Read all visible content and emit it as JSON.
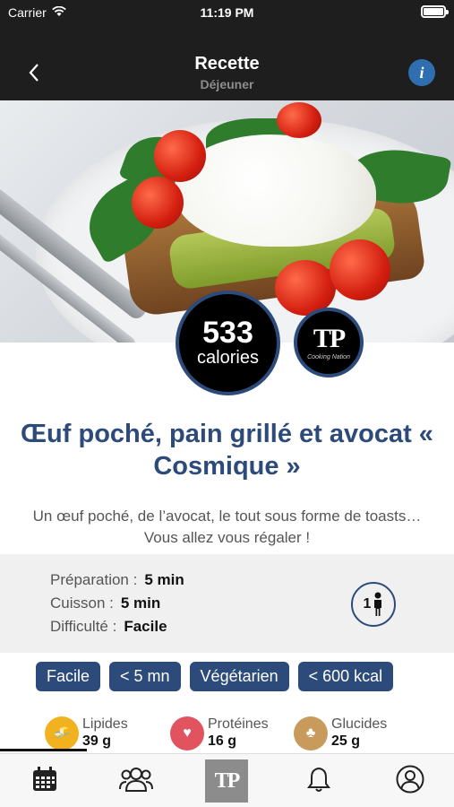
{
  "status": {
    "carrier": "Carrier",
    "time": "11:19 PM"
  },
  "nav": {
    "title": "Recette",
    "subtitle": "Déjeuner",
    "info_label": "i"
  },
  "badges": {
    "calories_value": "533",
    "calories_label": "calories",
    "brand_mark": "TP",
    "brand_sub": "Cooking Nation"
  },
  "recipe": {
    "title": "Œuf poché, pain grillé et avocat « Cosmique »",
    "description": "Un œuf poché, de l’avocat, le tout sous forme de toasts… Vous allez vous régaler !"
  },
  "details": {
    "prep_label": "Préparation :",
    "prep_value": "5 min",
    "cook_label": "Cuisson :",
    "cook_value": "5 min",
    "difficulty_label": "Difficulté :",
    "difficulty_value": "Facile",
    "servings": "1"
  },
  "tags": [
    "Facile",
    "< 5 mn",
    "Végétarien",
    "< 600 kcal"
  ],
  "nutrients": [
    {
      "name": "Lipides",
      "value": "39 g",
      "color": "#f2b11f"
    },
    {
      "name": "Protéines",
      "value": "16 g",
      "color": "#e0535f"
    },
    {
      "name": "Glucides",
      "value": "25 g",
      "color": "#c89a5b"
    }
  ],
  "tabbar": {
    "logo": "TP",
    "icons": [
      "calendar-icon",
      "users-icon",
      "logo",
      "bell-icon",
      "profile-icon"
    ]
  },
  "colors": {
    "brand_blue": "#2c4b7a",
    "header_bg": "#1e1e1e",
    "info_blue": "#2f6fb0"
  }
}
